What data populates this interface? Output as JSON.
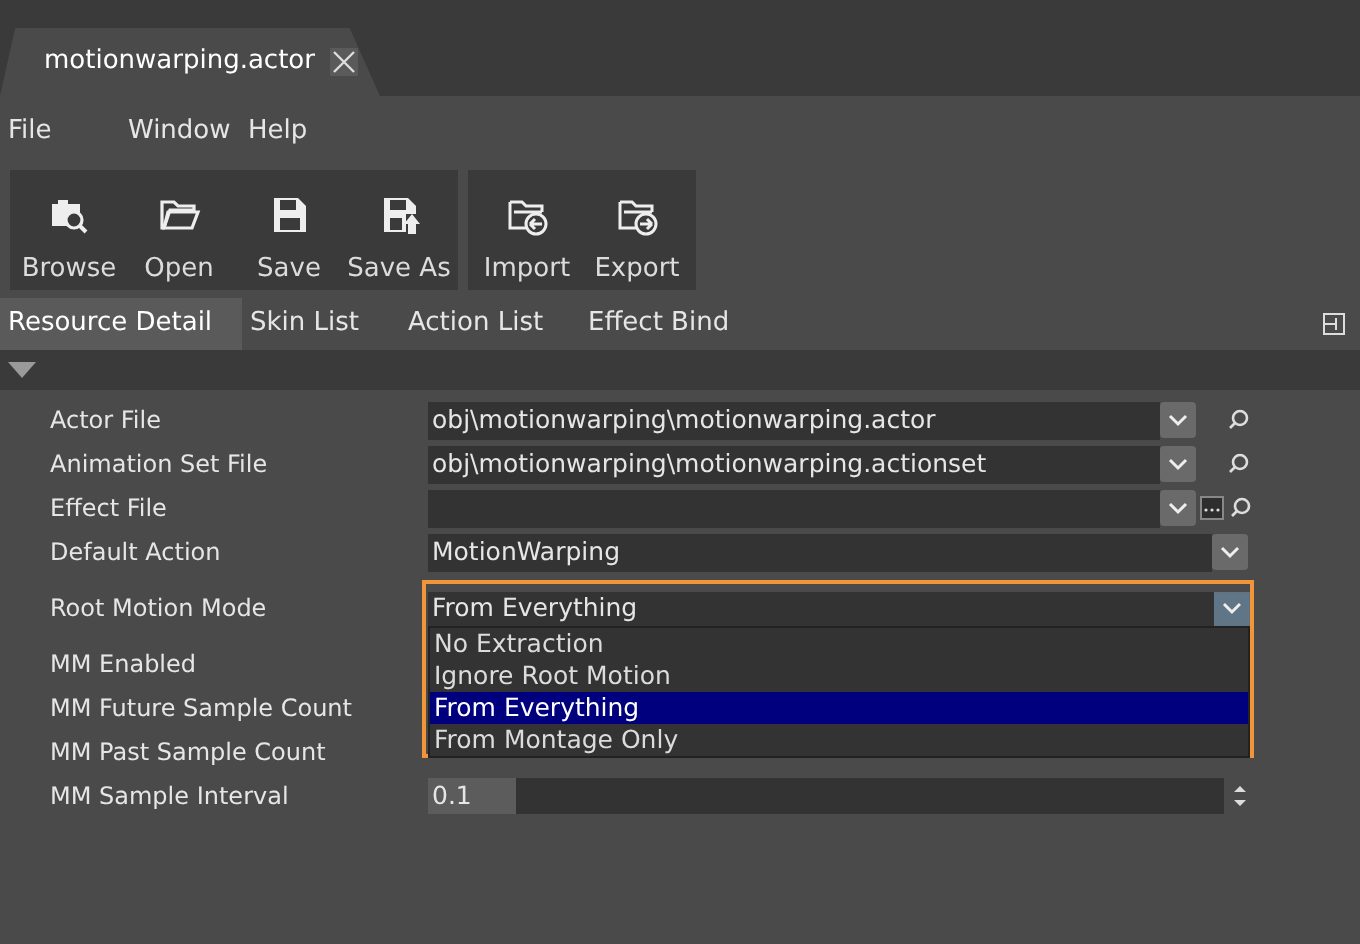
{
  "document_tab": {
    "title": "motionwarping.actor"
  },
  "menu": [
    "File",
    "Window",
    "Help"
  ],
  "toolbar_groups": [
    [
      {
        "kind": "browse",
        "label": "Browse"
      },
      {
        "kind": "open",
        "label": "Open"
      },
      {
        "kind": "save",
        "label": "Save"
      },
      {
        "kind": "saveas",
        "label": "Save As"
      }
    ],
    [
      {
        "kind": "import",
        "label": "Import"
      },
      {
        "kind": "export",
        "label": "Export"
      }
    ]
  ],
  "tabs": [
    {
      "label": "Resource Detail",
      "selected": true
    },
    {
      "label": "Skin List",
      "selected": false
    },
    {
      "label": "Action List",
      "selected": false
    },
    {
      "label": "Effect Bind",
      "selected": false
    }
  ],
  "properties": [
    {
      "label": "Actor File",
      "kind": "file",
      "value": "obj\\motionwarping\\motionwarping.actor"
    },
    {
      "label": "Animation Set File",
      "kind": "file",
      "value": "obj\\motionwarping\\motionwarping.actionset"
    },
    {
      "label": "Effect File",
      "kind": "file_browse"
    },
    {
      "label": "Default Action",
      "kind": "combo",
      "value": "MotionWarping"
    },
    {
      "label": "Root Motion Mode",
      "kind": "open_combo",
      "value": "From Everything",
      "options": [
        {
          "label": "No Extraction",
          "selected": false
        },
        {
          "label": "Ignore Root Motion",
          "selected": false
        },
        {
          "label": "From Everything",
          "selected": true
        },
        {
          "label": "From Montage Only",
          "selected": false
        }
      ]
    },
    {
      "label": "MM Enabled",
      "kind": "hidden"
    },
    {
      "label": "MM Future Sample Count",
      "kind": "hidden"
    },
    {
      "label": "MM Past Sample Count",
      "kind": "hidden"
    },
    {
      "label": "MM Sample Interval",
      "kind": "spin",
      "value": "0.1"
    }
  ]
}
